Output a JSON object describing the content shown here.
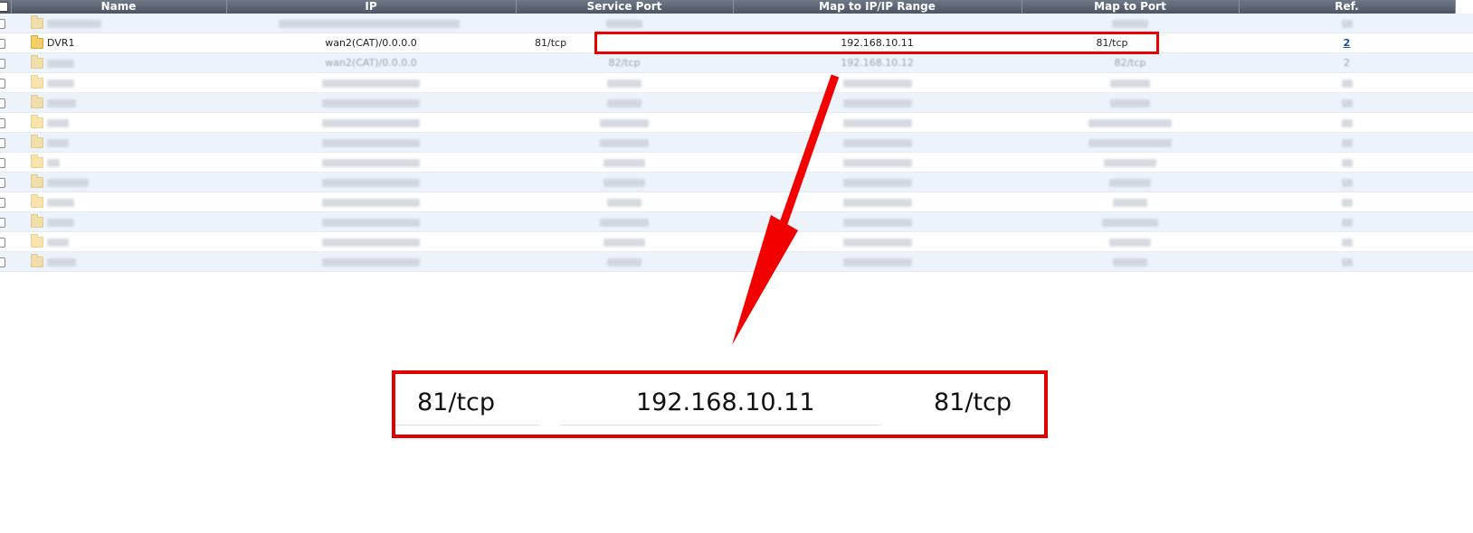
{
  "table": {
    "columns": [
      "Name",
      "IP",
      "Service Port",
      "Map to IP/IP Range",
      "Map to Port",
      "Ref."
    ],
    "visible_row": {
      "name": "DVR1",
      "ip": "wan2(CAT)/0.0.0.0",
      "service_port": "81/tcp",
      "map_ip": "192.168.10.11",
      "map_port": "81/tcp",
      "ref": "2"
    },
    "faint_row": {
      "ip": "wan2(CAT)/0.0.0.0",
      "service_port": "82/tcp",
      "map_ip": "192.168.10.12",
      "map_port": "82/tcp",
      "ref": "2"
    }
  },
  "zoom": {
    "service_port": "81/tcp",
    "map_ip": "192.168.10.11",
    "map_port": "81/tcp"
  },
  "colors": {
    "highlight": "#ea0000",
    "header_bg": "#5a6373",
    "row_alt": "#edf3fa"
  }
}
